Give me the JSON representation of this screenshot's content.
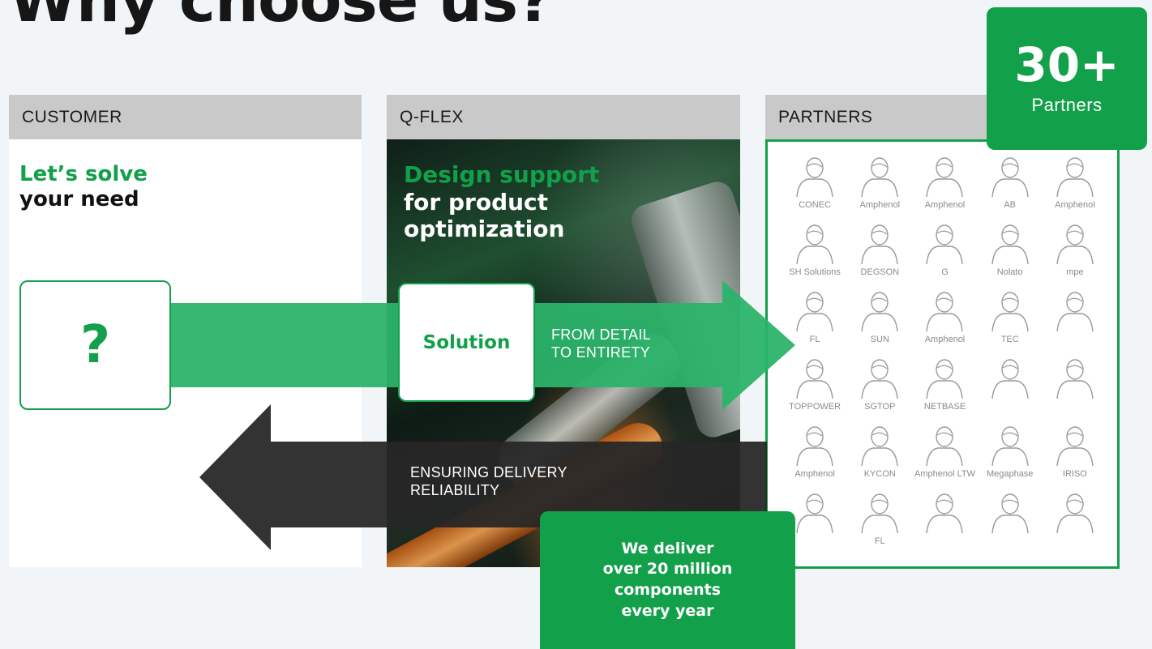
{
  "title": "Why choose us?",
  "columns": {
    "customer": "CUSTOMER",
    "qflex": "Q-FLEX",
    "partners": "PARTNERS"
  },
  "customer": {
    "headline_green": "Let’s solve",
    "headline_dark": "your need",
    "question_mark": "?"
  },
  "qflex": {
    "headline_green": "Design support",
    "headline_line2": "for product",
    "headline_line3": "optimization",
    "solution": "Solution",
    "arrow_right_label_line1": "FROM DETAIL",
    "arrow_right_label_line2": "TO ENTIRETY",
    "arrow_left_label_line1": "ENSURING DELIVERY",
    "arrow_left_label_line2": "RELIABILITY"
  },
  "partners_badge": {
    "count": "30+",
    "label": "Partners"
  },
  "delivery_badge": {
    "line1": "We deliver",
    "line2": "over 20 million",
    "line3": "components",
    "line4": "every year"
  },
  "partner_logos": [
    "CONEC",
    "Amphenol",
    "Amphenol",
    "AB",
    "Amphenol",
    "SH Solutions",
    "DEGSON",
    "G",
    "Nolato",
    "mpe",
    "FL",
    "SUN",
    "Amphenol",
    "TEC",
    "",
    "TOPPOWER",
    "SGTOP",
    "NETBASE",
    "",
    "",
    "Amphenol",
    "KYCON",
    "Amphenol LTW",
    "Megaphase",
    "IRISO",
    "",
    "FL",
    "",
    "",
    ""
  ],
  "colors": {
    "brand_green": "#12a04a",
    "arrow_green": "#2bb36a",
    "arrow_dark": "#2b2b2b",
    "header_gray": "#c9c9c9",
    "page_bg": "#f1f5f8"
  }
}
